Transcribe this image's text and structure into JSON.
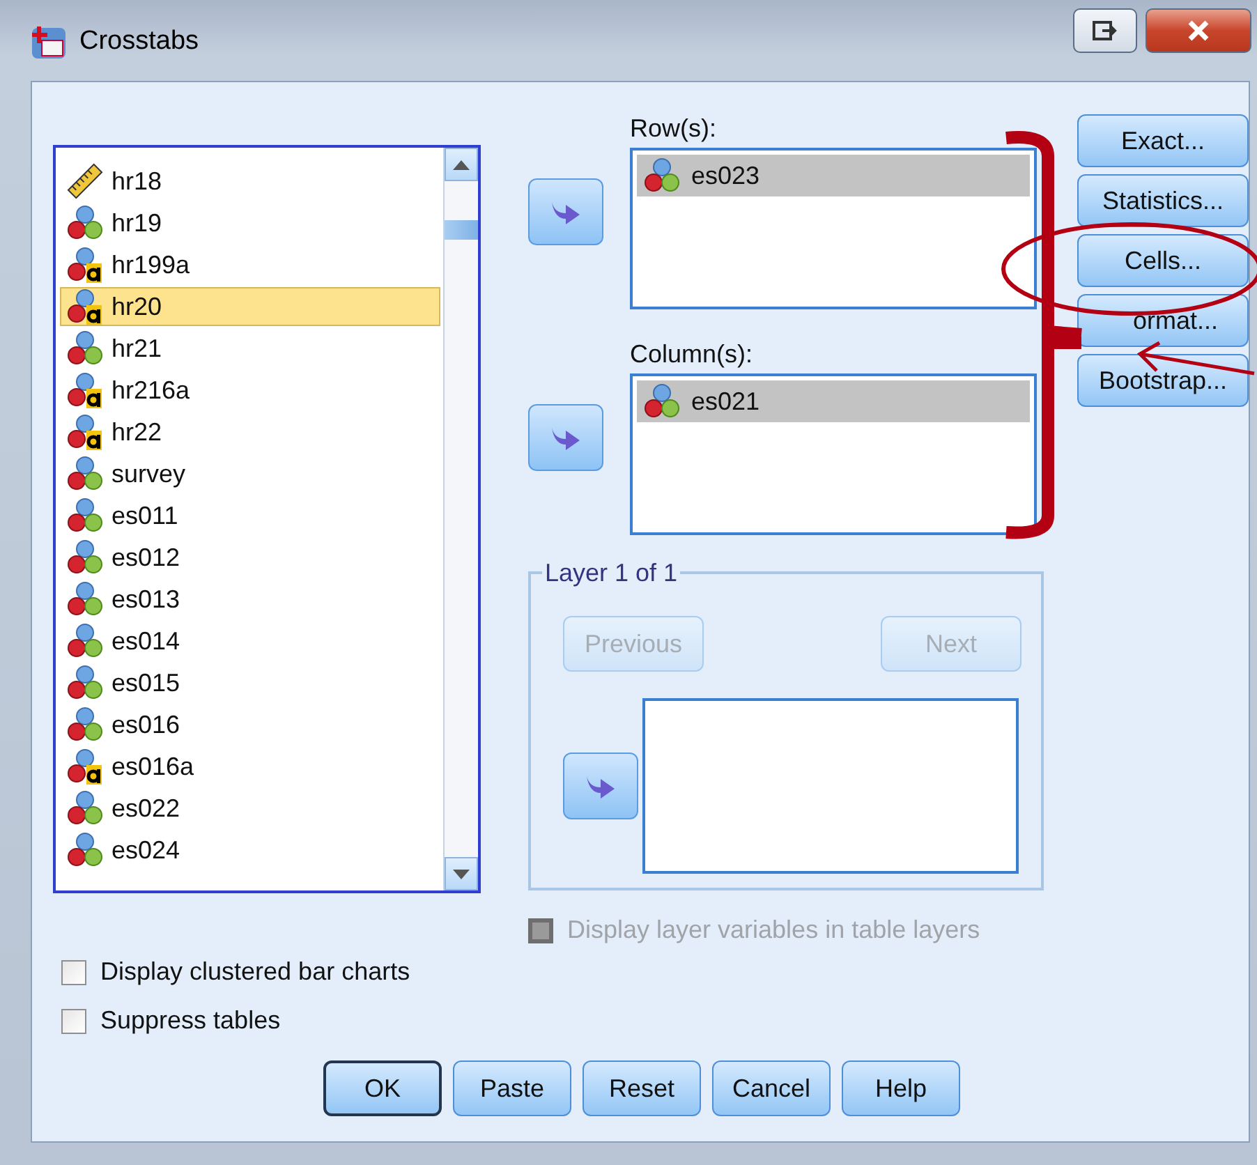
{
  "window": {
    "title": "Crosstabs"
  },
  "variables": [
    {
      "name": "hr18",
      "kind": "scale",
      "selected": false
    },
    {
      "name": "hr19",
      "kind": "nominal",
      "selected": false
    },
    {
      "name": "hr199a",
      "kind": "string",
      "selected": false
    },
    {
      "name": "hr20",
      "kind": "string",
      "selected": true
    },
    {
      "name": "hr21",
      "kind": "nominal",
      "selected": false
    },
    {
      "name": "hr216a",
      "kind": "string",
      "selected": false
    },
    {
      "name": "hr22",
      "kind": "string",
      "selected": false
    },
    {
      "name": "survey",
      "kind": "nominal",
      "selected": false
    },
    {
      "name": "es011",
      "kind": "nominal",
      "selected": false
    },
    {
      "name": "es012",
      "kind": "nominal",
      "selected": false
    },
    {
      "name": "es013",
      "kind": "nominal",
      "selected": false
    },
    {
      "name": "es014",
      "kind": "nominal",
      "selected": false
    },
    {
      "name": "es015",
      "kind": "nominal",
      "selected": false
    },
    {
      "name": "es016",
      "kind": "nominal",
      "selected": false
    },
    {
      "name": "es016a",
      "kind": "string",
      "selected": false
    },
    {
      "name": "es022",
      "kind": "nominal",
      "selected": false
    },
    {
      "name": "es024",
      "kind": "nominal",
      "selected": false
    }
  ],
  "rows": {
    "label": "Row(s):",
    "items": [
      {
        "name": "es023",
        "kind": "nominal",
        "selected": true
      }
    ]
  },
  "columns": {
    "label": "Column(s):",
    "items": [
      {
        "name": "es021",
        "kind": "nominal",
        "selected": true
      }
    ]
  },
  "layer": {
    "title": "Layer 1 of 1",
    "buttons": [
      {
        "label": "Previous",
        "disabled": true
      },
      {
        "label": "Next",
        "disabled": true
      }
    ]
  },
  "layer_option": {
    "label": "Display layer variables in table layers",
    "checked": false,
    "disabled": true
  },
  "side_buttons": [
    "Exact...",
    "Statistics...",
    "Cells...",
    "ormat...",
    "Bootstrap..."
  ],
  "options": [
    {
      "label": "Display clustered bar charts",
      "checked": false
    },
    {
      "label": "Suppress tables",
      "checked": false
    }
  ],
  "buttons": [
    {
      "label": "OK",
      "default": true
    },
    {
      "label": "Paste",
      "default": false
    },
    {
      "label": "Reset",
      "default": false
    },
    {
      "label": "Cancel",
      "default": false
    },
    {
      "label": "Help",
      "default": false
    }
  ]
}
